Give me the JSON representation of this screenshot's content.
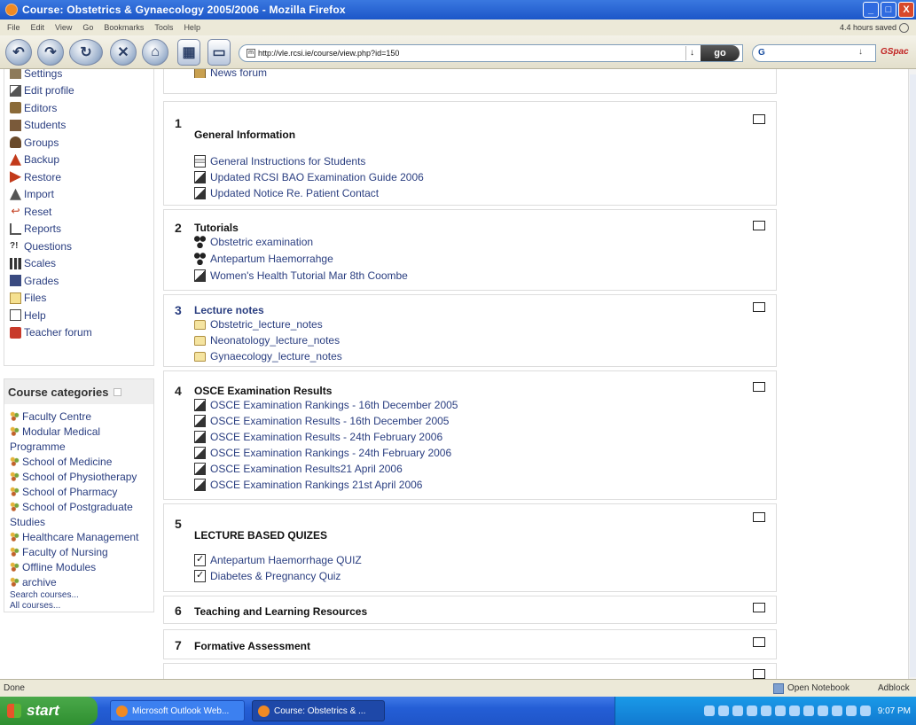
{
  "window": {
    "title": "Course: Obstetrics & Gynaecology 2005/2006 - Mozilla Firefox",
    "minimize_label": "_",
    "maximize_label": "□",
    "close_label": "X"
  },
  "menu": {
    "items": [
      "File",
      "Edit",
      "View",
      "Go",
      "Bookmarks",
      "Tools",
      "Help"
    ],
    "saved_text": "4.4 hours saved"
  },
  "toolbar": {
    "url": "http://vle.rcsi.ie/course/view.php?id=150",
    "site_icon": "m",
    "url_dropdown": "↓",
    "go_label": "go",
    "search_engine_label": "G",
    "search_dropdown": "↓",
    "gspace_label": "GSpac"
  },
  "sidebar": {
    "admin_items": [
      {
        "label": "Settings",
        "icon": "settings-icon"
      },
      {
        "label": "Edit profile",
        "icon": "edit-profile-icon"
      },
      {
        "label": "Editors",
        "icon": "editors-icon"
      },
      {
        "label": "Students",
        "icon": "students-icon"
      },
      {
        "label": "Groups",
        "icon": "groups-icon"
      },
      {
        "label": "Backup",
        "icon": "backup-icon"
      },
      {
        "label": "Restore",
        "icon": "restore-icon"
      },
      {
        "label": "Import",
        "icon": "import-icon"
      },
      {
        "label": "Reset",
        "icon": "reset-icon"
      },
      {
        "label": "Reports",
        "icon": "reports-icon"
      },
      {
        "label": "Questions",
        "icon": "questions-icon"
      },
      {
        "label": "Scales",
        "icon": "scales-icon"
      },
      {
        "label": "Grades",
        "icon": "grades-icon"
      },
      {
        "label": "Files",
        "icon": "files-icon"
      },
      {
        "label": "Help",
        "icon": "help-icon"
      },
      {
        "label": "Teacher forum",
        "icon": "teacher-forum-icon"
      }
    ],
    "reset_glyph": "↩",
    "questions_glyph": "?!",
    "categories_title": "Course categories",
    "categories": [
      "Faculty Centre",
      "Modular Medical Programme",
      "School of Medicine",
      "School of Physiotherapy",
      "School of Pharmacy",
      "School of Postgraduate Studies",
      "Healthcare Management",
      "Faculty of Nursing",
      "Offline Modules",
      "archive"
    ],
    "search_courses": "Search courses...",
    "all_courses": "All courses..."
  },
  "main": {
    "top_forum": "News forum",
    "sections": [
      {
        "num": "1",
        "title": "General Information",
        "resources": [
          "General Instructions for Students",
          "Updated RCSI BAO Examination Guide 2006",
          "Updated Notice Re. Patient Contact"
        ]
      },
      {
        "num": "2",
        "title": "Tutorials",
        "resources": [
          "Obstetric examination",
          "Antepartum Haemorrahge",
          "Women's Health Tutorial Mar 8th Coombe"
        ]
      },
      {
        "num": "3",
        "title": "Lecture notes",
        "resources": [
          "Obstetric_lecture_notes",
          "Neonatology_lecture_notes",
          "Gynaecology_lecture_notes"
        ]
      },
      {
        "num": "4",
        "title": "OSCE Examination Results",
        "resources": [
          "OSCE Examination Rankings - 16th December 2005",
          "OSCE Examination Results - 16th December 2005",
          "OSCE Examination Results - 24th February 2006",
          "OSCE Examination Rankings - 24th February 2006",
          "OSCE Examination Results21 April 2006",
          "OSCE Examination Rankings 21st April 2006"
        ]
      },
      {
        "num": "5",
        "title": "LECTURE BASED QUIZES",
        "resources": [
          "Antepartum Haemorrhage QUIZ",
          "Diabetes & Pregnancy Quiz"
        ]
      },
      {
        "num": "6",
        "title": "Teaching and Learning Resources",
        "resources": []
      },
      {
        "num": "7",
        "title": "Formative Assessment",
        "resources": []
      }
    ]
  },
  "status": {
    "text": "Done",
    "notebook": "Open Notebook",
    "adblock": "Adblock"
  },
  "taskbar": {
    "start_label": "start",
    "tasks": [
      "Microsoft Outlook Web...",
      "Course: Obstetrics & ..."
    ],
    "clock": "9:07 PM"
  },
  "colors": {
    "link": "#2a3e80",
    "titlebar": "#1c56c8",
    "taskbar": "#245ed6",
    "start": "#2f8f30"
  }
}
